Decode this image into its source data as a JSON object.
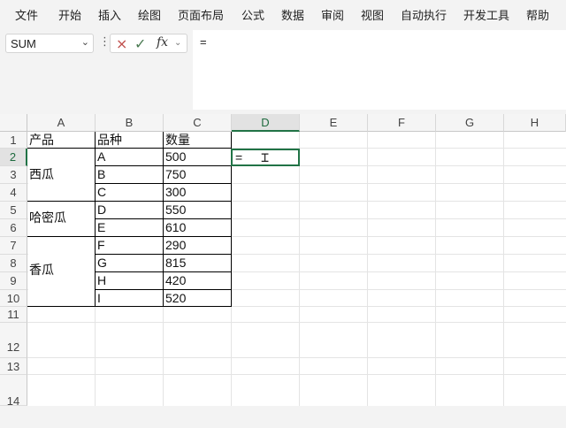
{
  "menu": {
    "items": [
      "文件",
      "开始",
      "插入",
      "绘图",
      "页面布局",
      "公式",
      "数据",
      "审阅",
      "视图",
      "自动执行",
      "开发工具",
      "帮助"
    ]
  },
  "formula_bar": {
    "name_box": "SUM",
    "cancel_icon": "×",
    "enter_icon": "✓",
    "fx_label": "fx",
    "content": "="
  },
  "sheet": {
    "columns": [
      "A",
      "B",
      "C",
      "D",
      "E",
      "F",
      "G",
      "H"
    ],
    "rows": [
      "1",
      "2",
      "3",
      "4",
      "5",
      "6",
      "7",
      "8",
      "9",
      "10",
      "11",
      "12",
      "13",
      "14"
    ],
    "active_cell": "D2",
    "active_cell_text": "=",
    "header": {
      "product": "产品",
      "variety": "品种",
      "quantity": "数量"
    },
    "groups": [
      "西瓜",
      "哈密瓜",
      "香瓜"
    ],
    "varieties": [
      "A",
      "B",
      "C",
      "D",
      "E",
      "F",
      "G",
      "H",
      "I"
    ],
    "quantities": [
      "500",
      "750",
      "300",
      "550",
      "610",
      "290",
      "815",
      "420",
      "520"
    ]
  },
  "colors": {
    "accent": "#217346",
    "cancel": "#c0504d"
  }
}
